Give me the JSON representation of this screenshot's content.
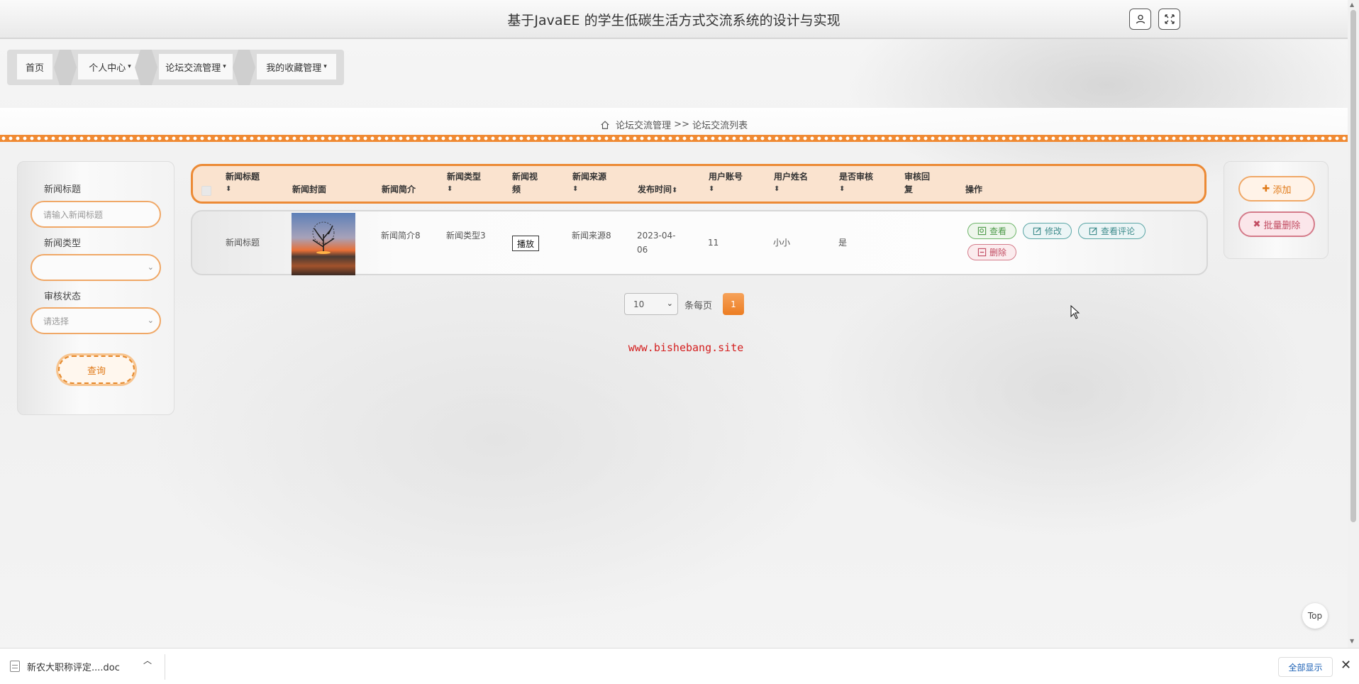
{
  "header": {
    "title": "基于JavaEE 的学生低碳生活方式交流系统的设计与实现"
  },
  "nav": {
    "items": [
      {
        "label": "首页"
      },
      {
        "label": "个人中心"
      },
      {
        "label": "论坛交流管理"
      },
      {
        "label": "我的收藏管理"
      }
    ],
    "caret": "▾"
  },
  "breadcrumb": {
    "section": "论坛交流管理",
    "separator": ">>",
    "page": "论坛交流列表"
  },
  "search": {
    "title_label": "新闻标题",
    "title_placeholder": "请输入新闻标题",
    "type_label": "新闻类型",
    "type_value": "",
    "status_label": "审核状态",
    "status_placeholder": "请选择",
    "query_button": "查询"
  },
  "table": {
    "columns": [
      {
        "label": "新闻标题",
        "sortable": true
      },
      {
        "label": "新闻封面",
        "sortable": false
      },
      {
        "label": "新闻简介",
        "sortable": false
      },
      {
        "label": "新闻类型",
        "sortable": true
      },
      {
        "label": "新闻视频",
        "sortable": false
      },
      {
        "label": "新闻来源",
        "sortable": true
      },
      {
        "label": "发布时间",
        "sortable": true
      },
      {
        "label": "用户账号",
        "sortable": true
      },
      {
        "label": "用户姓名",
        "sortable": true
      },
      {
        "label": "是否审核",
        "sortable": true
      },
      {
        "label": "审核回复",
        "sortable": false
      },
      {
        "label": "操作",
        "sortable": false
      }
    ],
    "sort_icon": "⬍",
    "rows": [
      {
        "title": "新闻标题",
        "intro": "新闻简介8",
        "type": "新闻类型3",
        "video_button": "播放",
        "source": "新闻来源8",
        "publish_time": "2023-04-06",
        "account": "11",
        "name": "小小",
        "reviewed": "是",
        "reply": ""
      }
    ],
    "actions": {
      "view": "查看",
      "edit": "修改",
      "comments": "查看评论",
      "delete": "删除"
    }
  },
  "pager": {
    "page_size": "10",
    "per_page_text": "条每页",
    "current_page": "1"
  },
  "watermark": "www.bishebang.site",
  "side_actions": {
    "add": "添加",
    "batch_delete": "批量删除"
  },
  "top_button": "Top",
  "download_bar": {
    "file_name": "新农大职称评定....doc",
    "show_all": "全部显示"
  },
  "colors": {
    "accent": "#ec8a35",
    "success": "#6eb56a",
    "info": "#5aa6a6",
    "danger": "#d47b8a"
  }
}
